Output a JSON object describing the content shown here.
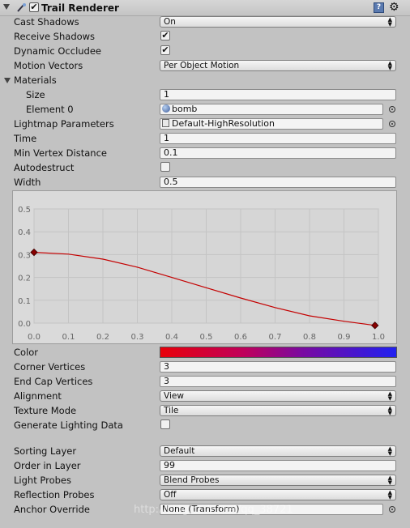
{
  "component": {
    "title": "Trail Renderer",
    "enabled": true,
    "icons": [
      "trail-renderer-icon",
      "help-icon",
      "settings-gear-icon"
    ]
  },
  "rows": {
    "cast_shadows": {
      "label": "Cast Shadows",
      "value": "On"
    },
    "receive_shadows": {
      "label": "Receive Shadows",
      "checked": true
    },
    "dynamic_occludee": {
      "label": "Dynamic Occludee",
      "checked": true
    },
    "motion_vectors": {
      "label": "Motion Vectors",
      "value": "Per Object Motion"
    },
    "materials": {
      "label": "Materials",
      "expanded": true
    },
    "size": {
      "label": "Size",
      "value": "1"
    },
    "element0": {
      "label": "Element 0",
      "value": "bomb"
    },
    "lightmap_parameters": {
      "label": "Lightmap Parameters",
      "value": "Default-HighResolution"
    },
    "time": {
      "label": "Time",
      "value": "1"
    },
    "min_vertex_distance": {
      "label": "Min Vertex Distance",
      "value": "0.1"
    },
    "autodestruct": {
      "label": "Autodestruct",
      "checked": false
    },
    "width": {
      "label": "Width",
      "value": "0.5"
    },
    "color": {
      "label": "Color"
    },
    "corner_vertices": {
      "label": "Corner Vertices",
      "value": "3"
    },
    "end_cap_vertices": {
      "label": "End Cap Vertices",
      "value": "3"
    },
    "alignment": {
      "label": "Alignment",
      "value": "View"
    },
    "texture_mode": {
      "label": "Texture Mode",
      "value": "Tile"
    },
    "generate_lighting_data": {
      "label": "Generate Lighting Data",
      "checked": false
    },
    "sorting_layer": {
      "label": "Sorting Layer",
      "value": "Default"
    },
    "order_in_layer": {
      "label": "Order in Layer",
      "value": "99"
    },
    "light_probes": {
      "label": "Light Probes",
      "value": "Blend Probes"
    },
    "reflection_probes": {
      "label": "Reflection Probes",
      "value": "Off"
    },
    "anchor_override": {
      "label": "Anchor Override",
      "value": "None (Transform)"
    }
  },
  "gradient": {
    "start": "#e8000a",
    "end": "#2020f0"
  },
  "watermark": "http://blog.csdn.net/qq_38721",
  "chart_data": {
    "type": "line",
    "x_ticks": [
      "0.0",
      "0.1",
      "0.2",
      "0.3",
      "0.4",
      "0.5",
      "0.6",
      "0.7",
      "0.8",
      "0.9",
      "1.0"
    ],
    "y_ticks": [
      "0.0",
      "0.1",
      "0.2",
      "0.3",
      "0.4",
      "0.5"
    ],
    "xlim": [
      0,
      1.0
    ],
    "ylim": [
      0,
      0.5
    ],
    "grid": true,
    "curve_color": "#c40000",
    "keys": [
      {
        "x": 0.0,
        "y": 0.31
      },
      {
        "x": 0.99,
        "y": -0.01
      }
    ],
    "series": [
      {
        "x": [
          0,
          0.1,
          0.2,
          0.3,
          0.4,
          0.5,
          0.6,
          0.7,
          0.8,
          0.9,
          0.99
        ],
        "y": [
          0.31,
          0.302,
          0.28,
          0.245,
          0.2,
          0.155,
          0.11,
          0.068,
          0.032,
          0.008,
          -0.01
        ]
      }
    ]
  }
}
